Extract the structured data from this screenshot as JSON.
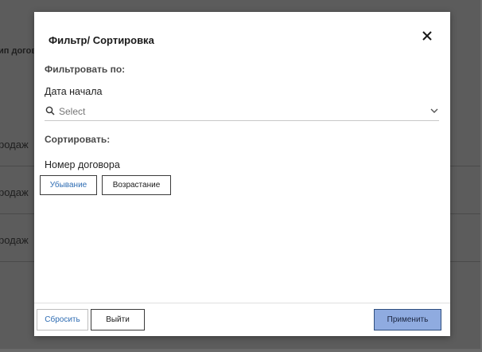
{
  "background": {
    "column_header": "ип догов",
    "rows": [
      "родаж",
      "родаж",
      "родаж"
    ]
  },
  "modal": {
    "title": "Фильтр/ Сортировка",
    "close_icon": "close-icon",
    "filter_section_label": "Фильтровать по:",
    "start_date_label": "Дата начала",
    "start_date_select": {
      "value": "",
      "placeholder": "Select",
      "icon": "search-icon",
      "dropdown_icon": "chevron-down-icon"
    },
    "sort_section_label": "Сортировать:",
    "contract_number_label": "Номер договора",
    "sort_desc_label": "Убывание",
    "sort_asc_label": "Возрастание",
    "footer": {
      "reset_label": "Сбросить",
      "exit_label": "Выйти",
      "apply_label": "Применить"
    }
  },
  "colors": {
    "accent_blue": "#2f6db3",
    "apply_bg": "#8fabe0",
    "overlay": "#5c5c5c"
  }
}
